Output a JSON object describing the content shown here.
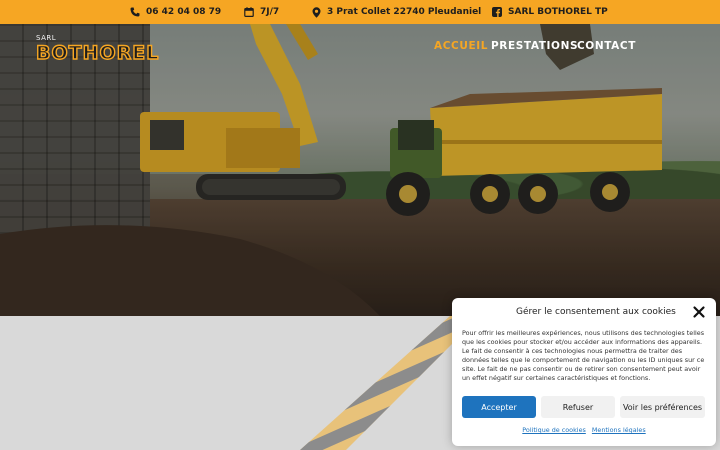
{
  "topbar": {
    "phone": "06 42 04 08 79",
    "hours": "7J/7",
    "address": "3 Prat Collet 22740 Pleudaniel",
    "facebook": "SARL BOTHOREL TP"
  },
  "logo": {
    "prefix": "SARL",
    "name": "BOTHOREL"
  },
  "nav": {
    "items": [
      {
        "label": "ACCUEIL",
        "active": true
      },
      {
        "label": "PRESTATIONS",
        "active": false
      },
      {
        "label": "CONTACT",
        "active": false
      }
    ]
  },
  "cookie": {
    "title": "Gérer le consentement aux cookies",
    "body": "Pour offrir les meilleures expériences, nous utilisons des technologies telles que les cookies pour stocker et/ou accéder aux informations des appareils. Le fait de consentir à ces technologies nous permettra de traiter des données telles que le comportement de navigation ou les ID uniques sur ce site. Le fait de ne pas consentir ou de retirer son consentement peut avoir un effet négatif sur certaines caractéristiques et fonctions.",
    "accept": "Accepter",
    "refuse": "Refuser",
    "preferences": "Voir les préférences",
    "link_cookies": "Politique de cookies",
    "link_legal": "Mentions légales"
  },
  "colors": {
    "accent": "#f6a623",
    "primary_button": "#1e73be",
    "text_dark": "#1e1e1e"
  },
  "icons": [
    "phone-icon",
    "calendar-icon",
    "location-pin-icon",
    "facebook-icon",
    "close-icon"
  ]
}
